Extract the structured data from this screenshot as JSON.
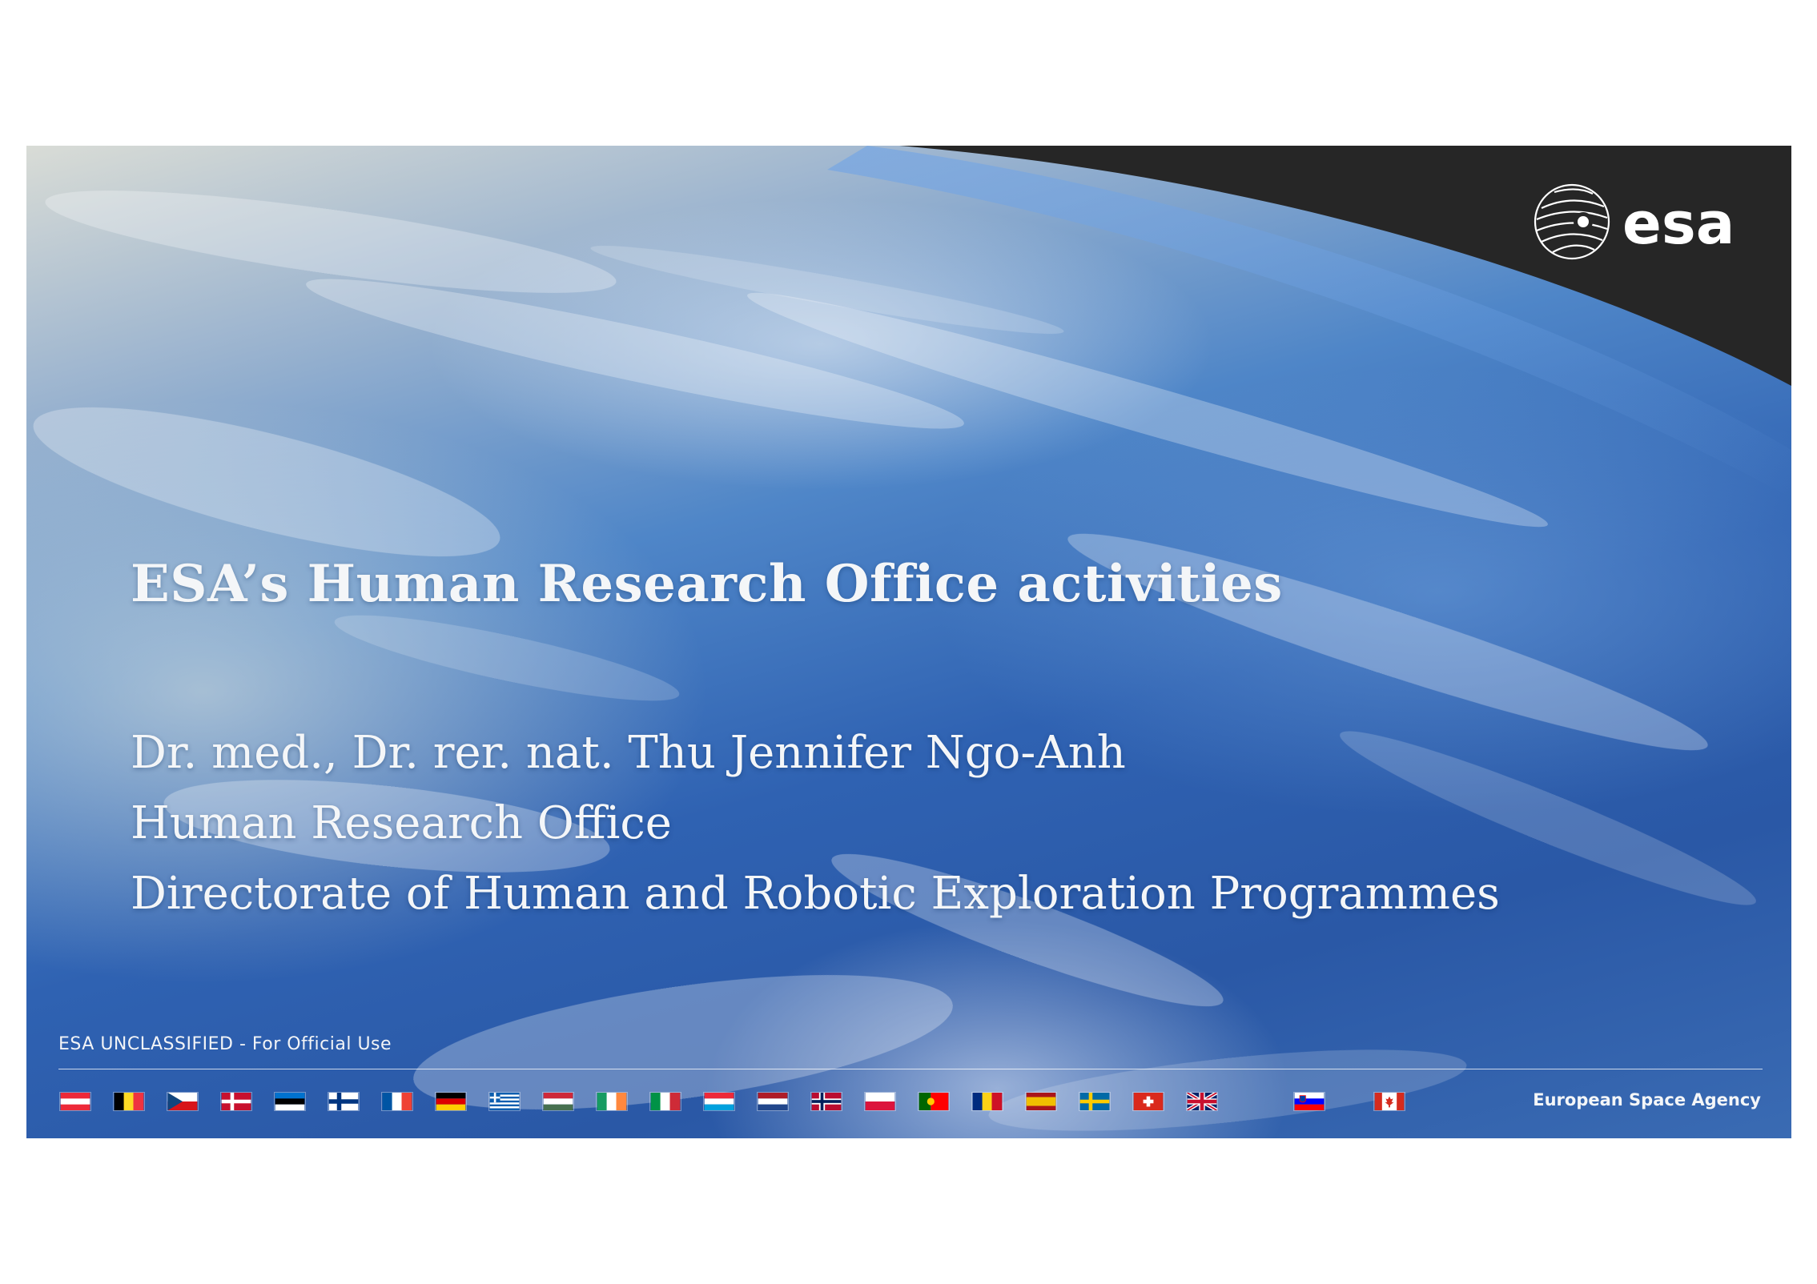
{
  "slide": {
    "title": "ESA’s Human Research Office activities",
    "author_lines": [
      "Dr. med., Dr. rer. nat. Thu Jennifer Ngo-Anh",
      "Human Research Office",
      "Directorate of Human and Robotic Exploration Programmes"
    ],
    "classification": "ESA UNCLASSIFIED - For Official Use",
    "agency_name": "European Space Agency",
    "logo_text": "esa"
  },
  "flags": [
    {
      "country": "Austria",
      "icon": "austria-flag-icon"
    },
    {
      "country": "Belgium",
      "icon": "belgium-flag-icon"
    },
    {
      "country": "Czech Republic",
      "icon": "czech-flag-icon"
    },
    {
      "country": "Denmark",
      "icon": "denmark-flag-icon"
    },
    {
      "country": "Estonia",
      "icon": "estonia-flag-icon"
    },
    {
      "country": "Finland",
      "icon": "finland-flag-icon"
    },
    {
      "country": "France",
      "icon": "france-flag-icon"
    },
    {
      "country": "Germany",
      "icon": "germany-flag-icon"
    },
    {
      "country": "Greece",
      "icon": "greece-flag-icon"
    },
    {
      "country": "Hungary",
      "icon": "hungary-flag-icon"
    },
    {
      "country": "Ireland",
      "icon": "ireland-flag-icon"
    },
    {
      "country": "Italy",
      "icon": "italy-flag-icon"
    },
    {
      "country": "Luxembourg",
      "icon": "luxembourg-flag-icon"
    },
    {
      "country": "Netherlands",
      "icon": "netherlands-flag-icon"
    },
    {
      "country": "Norway",
      "icon": "norway-flag-icon"
    },
    {
      "country": "Poland",
      "icon": "poland-flag-icon"
    },
    {
      "country": "Portugal",
      "icon": "portugal-flag-icon"
    },
    {
      "country": "Romania",
      "icon": "romania-flag-icon"
    },
    {
      "country": "Spain",
      "icon": "spain-flag-icon"
    },
    {
      "country": "Sweden",
      "icon": "sweden-flag-icon"
    },
    {
      "country": "Switzerland",
      "icon": "switzerland-flag-icon"
    },
    {
      "country": "United Kingdom",
      "icon": "uk-flag-icon"
    },
    {
      "country": "Slovenia",
      "icon": "slovenia-flag-icon"
    },
    {
      "country": "Canada",
      "icon": "canada-flag-icon"
    }
  ],
  "colors": {
    "space_black": "#262626",
    "text_white": "#f4f6f8",
    "ocean_blue": "#2f62b2"
  }
}
